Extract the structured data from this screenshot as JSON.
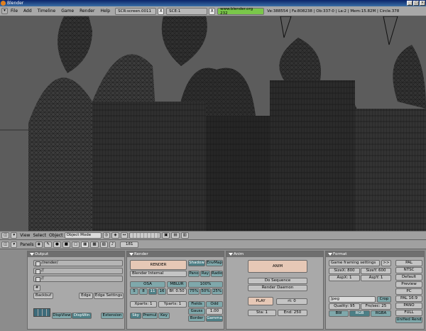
{
  "window": {
    "title": "Blender"
  },
  "menubar": {
    "items": [
      "File",
      "Add",
      "Timeline",
      "Game",
      "Render",
      "Help"
    ],
    "screen_field": "SCR:screen.0011",
    "scene_field": "SCE:1",
    "url": "www.blender.org 232",
    "stats": "Ve:388554 | Fa:808238 | Ob:337-0 | La:2 | Mem:15.82M | Circle.378",
    "close_glyph": "X"
  },
  "view_toolbar": {
    "items": [
      "View",
      "Select",
      "Object"
    ],
    "mode": "Object Mode"
  },
  "panels_toolbar": {
    "label": "Panels",
    "page_number": "181"
  },
  "output": {
    "title": "Output",
    "render_path": "//render/",
    "path2": "//",
    "path3": "//",
    "backbuf": "Backbuf",
    "edge": "Edge",
    "edge_settings": "Edge Settings",
    "dispview": "DispView",
    "dispwin": "DispWin",
    "extension": "Extension",
    "small_btn": "#"
  },
  "render": {
    "title": "Render",
    "render_btn": "RENDER",
    "renderer": "Blender Internal",
    "shadow": "Shadow",
    "envmap": "EnvMap",
    "pano": "Pano",
    "ray": "Ray",
    "radio": "Radio",
    "osa": "OSA",
    "mblur": "MBLUR",
    "osa_levels": [
      "5",
      "8",
      "11",
      "16"
    ],
    "bf": "Bf: 0.50",
    "percent100": "100%",
    "p75": "75%",
    "p50": "50%",
    "p25": "25%",
    "xparts": "Xparts: 1",
    "yparts": "Yparts: 1",
    "fields": "Fields",
    "odd": "Odd",
    "gauss": "Gauss",
    "gauss_val": "1.00",
    "sky": "Sky",
    "premul": "Premul",
    "key": "Key",
    "border": "Border",
    "gamma": "Gamma"
  },
  "anim": {
    "title": "Anim",
    "anim_btn": "ANIM",
    "do_sequence": "Do Sequence",
    "render_daemon": "Render Daemon",
    "play": "PLAY",
    "rt": "rt: 0",
    "sta": "Sta: 1",
    "end": "End: 250"
  },
  "format": {
    "title": "Format",
    "game_framing": "Game framing settings",
    "game_arrow": ">>",
    "sizex": "SizeX: 800",
    "sizey": "SizeY: 600",
    "aspx": "AspX: 1",
    "aspy": "AspY: 1",
    "codec": "Jpeg",
    "crop": "Crop",
    "quality": "Quality: 95",
    "frsec": "Frs/sec: 25",
    "bw": "BW",
    "rgb": "RGB",
    "rgba": "RGBA",
    "presets": [
      "PAL",
      "NTSC",
      "Default",
      "Preview",
      "PC",
      "PAL 16:9",
      "PANO",
      "FULL",
      "Unified Rend"
    ]
  }
}
